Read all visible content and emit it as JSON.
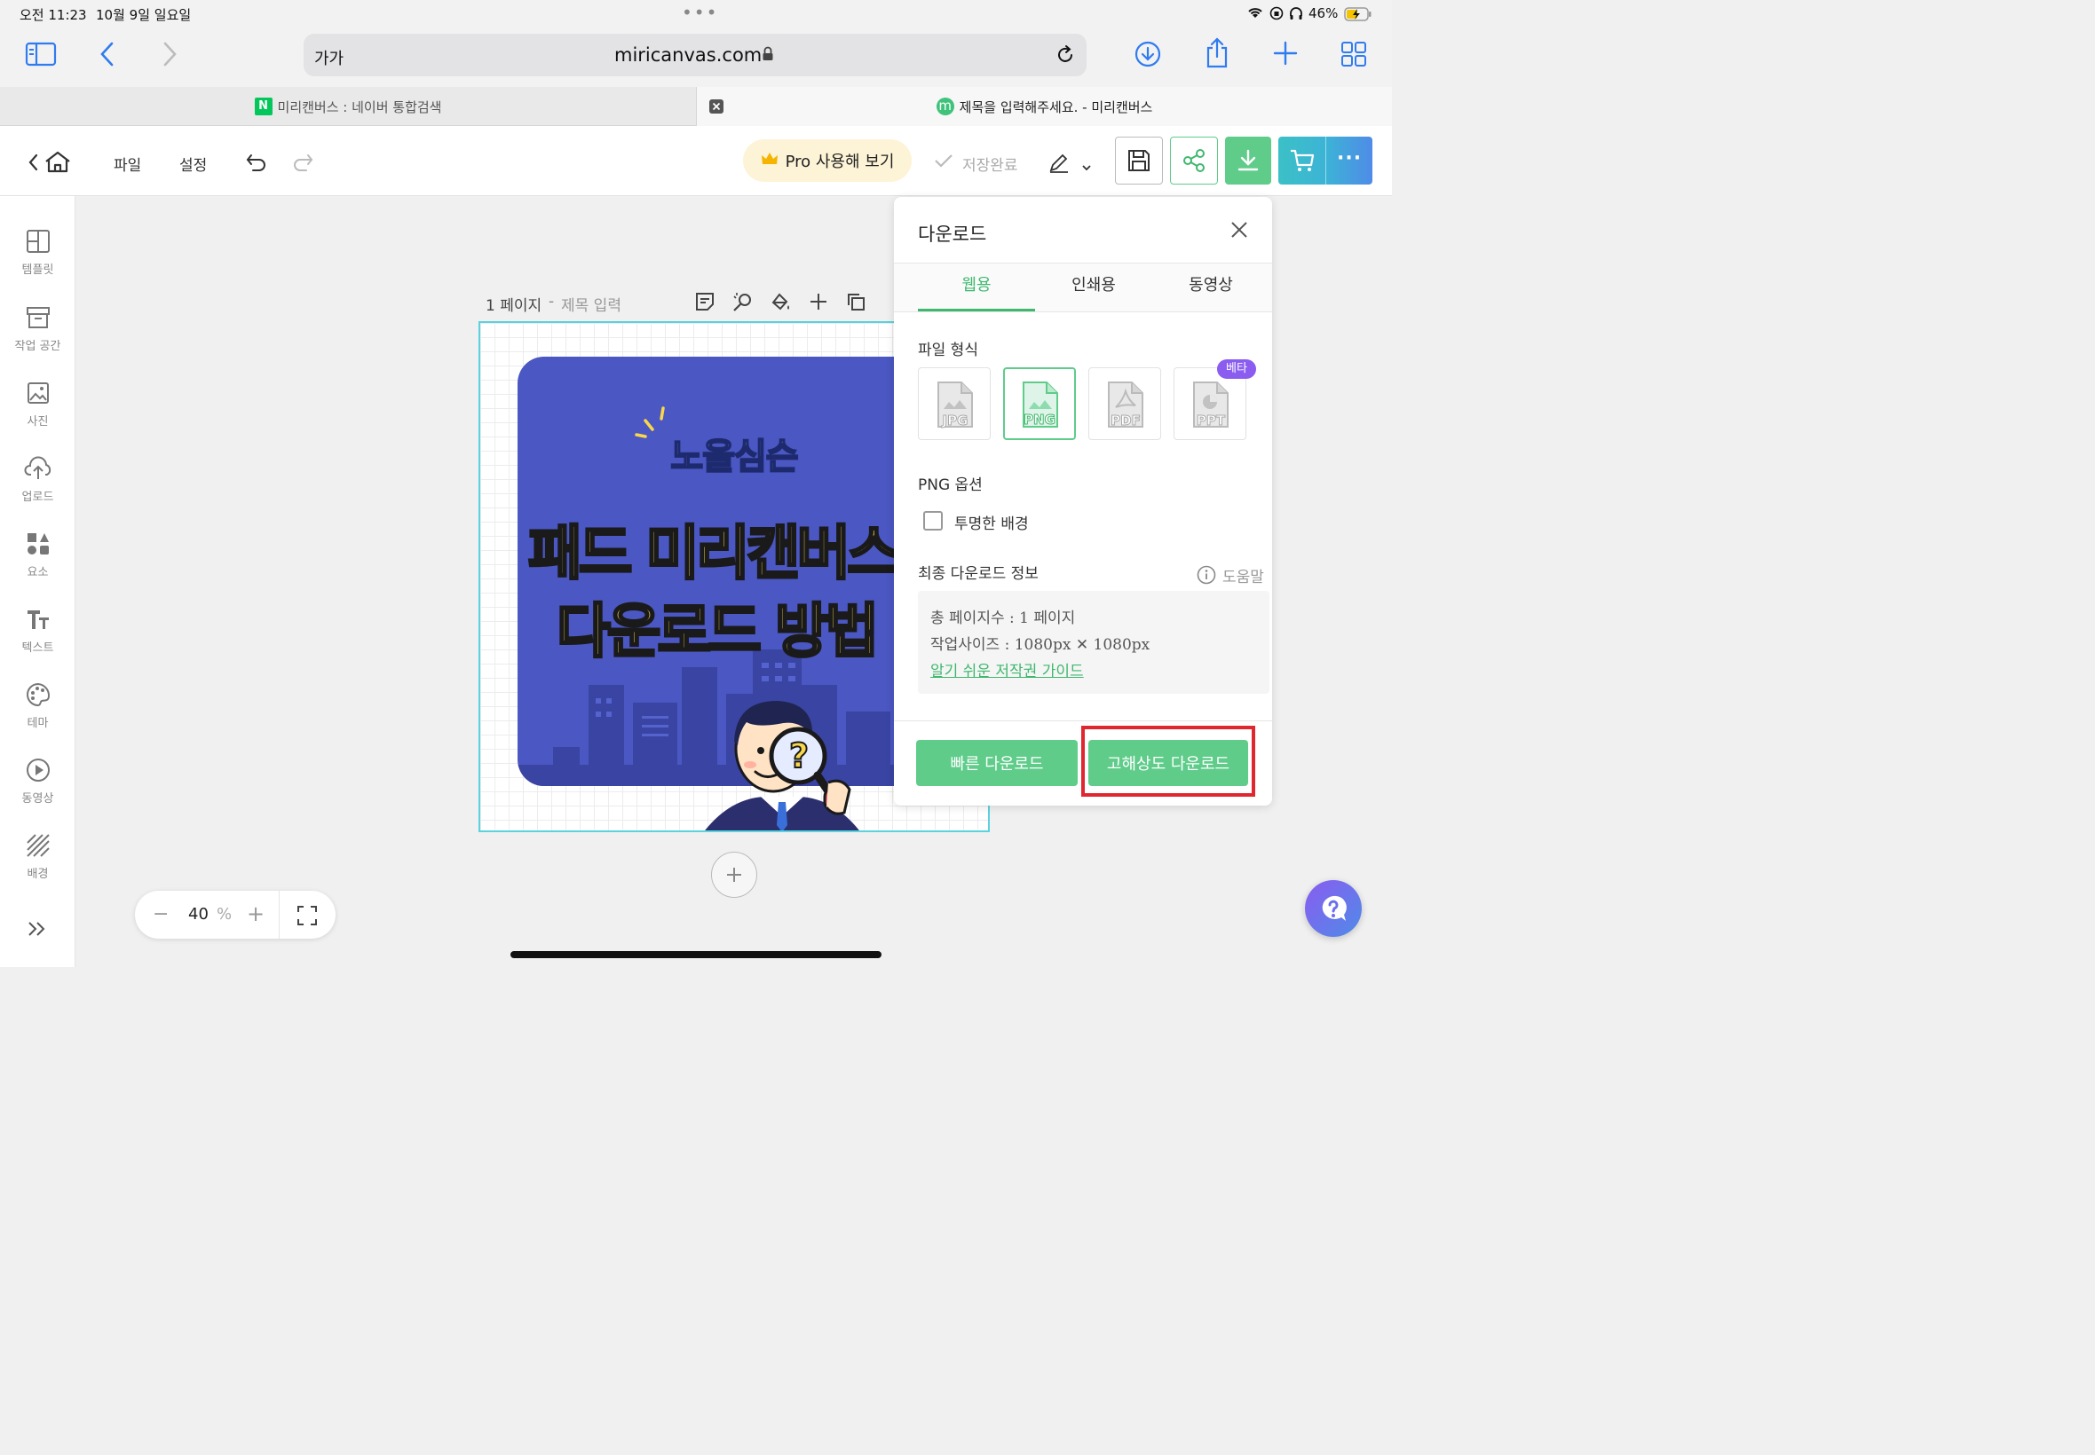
{
  "status": {
    "time": "오전 11:23",
    "date": "10월 9일 일요일",
    "battery": "46%"
  },
  "browser": {
    "text_size": "가가",
    "url": "miricanvas.com"
  },
  "tabs": [
    {
      "label": "미리캔버스 : 네이버 통합검색",
      "favicon": "N"
    },
    {
      "label": "제목을 입력해주세요. - 미리캔버스",
      "favicon": "m"
    }
  ],
  "toolbar": {
    "file": "파일",
    "settings": "설정",
    "pro": "Pro 사용해 보기",
    "saved": "저장완료"
  },
  "sidebar": [
    {
      "label": "템플릿",
      "icon": "template-icon"
    },
    {
      "label": "작업 공간",
      "icon": "workspace-icon"
    },
    {
      "label": "사진",
      "icon": "photo-icon"
    },
    {
      "label": "업로드",
      "icon": "upload-icon"
    },
    {
      "label": "요소",
      "icon": "elements-icon"
    },
    {
      "label": "텍스트",
      "icon": "text-icon"
    },
    {
      "label": "테마",
      "icon": "theme-icon"
    },
    {
      "label": "동영상",
      "icon": "video-icon"
    },
    {
      "label": "배경",
      "icon": "background-icon"
    }
  ],
  "page": {
    "number": "1 페이지",
    "separator": "-",
    "title_placeholder": "제목 입력"
  },
  "design": {
    "small_title": "노을심슨",
    "line1": "패드 미리캔버스",
    "line2": "다운로드 방법",
    "badge": "?"
  },
  "zoom": {
    "value": "40",
    "unit": "%"
  },
  "panel": {
    "title": "다운로드",
    "tabs": [
      "웹용",
      "인쇄용",
      "동영상"
    ],
    "file_format_label": "파일 형식",
    "formats": [
      "JPG",
      "PNG",
      "PDF",
      "PPT"
    ],
    "beta": "베타",
    "png_options_label": "PNG 옵션",
    "transparent_bg": "투명한 배경",
    "final_info_label": "최종 다운로드 정보",
    "help": "도움말",
    "total_pages": "총 페이지수 : 1 페이지",
    "work_size": "작업사이즈 : 1080px ✕ 1080px",
    "copyright_guide": "알기 쉬운 저작권 가이드",
    "quick_download": "빠른 다운로드",
    "hd_download": "고해상도 다운로드"
  },
  "colors": {
    "accent_green": "#5fcc8a",
    "design_blue": "#4b57c2",
    "design_yellow": "#f9d74a",
    "highlight_red": "#e0262e"
  }
}
